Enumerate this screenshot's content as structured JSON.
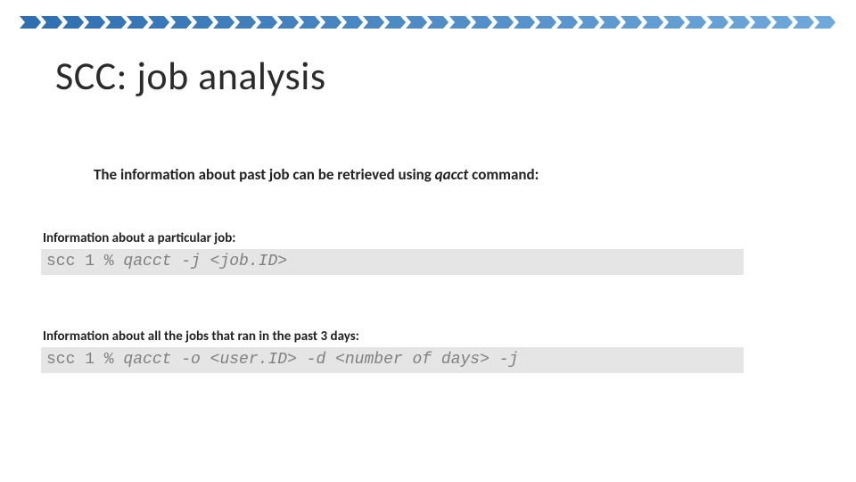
{
  "title": "SCC: job analysis",
  "intro": {
    "pre": "The information about past job can be retrieved using ",
    "cmd": "qacct",
    "post": " command:"
  },
  "block1": {
    "caption": "Information about a particular job:",
    "prompt": "scc 1 % ",
    "cmd": "qacct -j ",
    "arg": "<job.ID>"
  },
  "block2": {
    "caption": "Information about all the jobs that ran in the past 3 days:",
    "prompt": "scc 1 % ",
    "cmd": "qacct -o ",
    "arg1": "<user.ID>",
    "mid": " -d ",
    "arg2": "<number of days>",
    "tail": " -j"
  },
  "deco": {
    "count": 38,
    "start": "#2f6fb1",
    "end": "#6fa9db"
  }
}
